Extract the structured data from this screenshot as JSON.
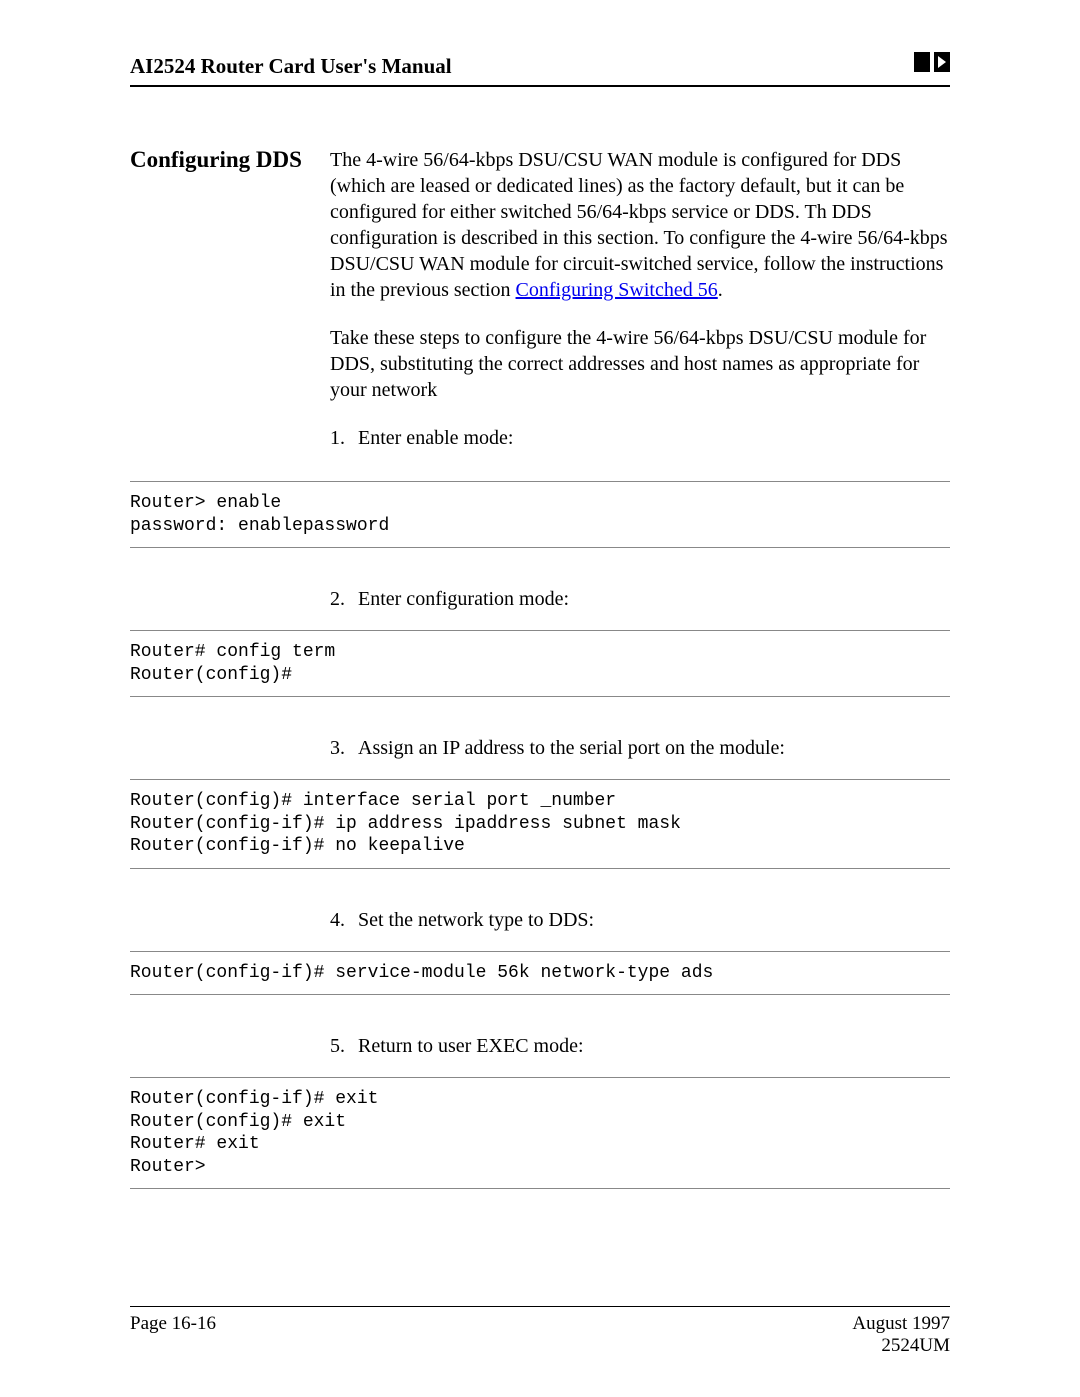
{
  "header": {
    "title": "AI2524 Router Card User's Manual"
  },
  "section": {
    "title": "Configuring DDS",
    "para1_a": "The 4-wire 56/64-kbps DSU/CSU WAN module is configured for DDS (which are leased or dedicated lines) as the factory default, but it can be configured for either switched 56/64-kbps service or DDS. Th DDS configuration is described in this section. To configure the 4-wire 56/64-kbps DSU/CSU WAN module for circuit-switched service, follow the instructions in the previous section ",
    "para1_link": "Configuring Switched 56",
    "para1_b": ".",
    "para2": "Take these steps to configure the 4-wire 56/64-kbps DSU/CSU module for DDS, substituting the correct addresses and host names as appropriate for your network",
    "steps": {
      "n1": "1.",
      "s1": "Enter enable mode:",
      "n2": "2.",
      "s2": "Enter configuration mode:",
      "n3": "3.",
      "s3": "Assign an IP address to the serial port on the module:",
      "n4": "4.",
      "s4": "Set the network type to DDS:",
      "n5": "5.",
      "s5": "Return to user EXEC mode:"
    }
  },
  "code": {
    "c1": "Router> enable\npassword: enablepassword",
    "c2": "Router# config term\nRouter(config)#",
    "c3": "Router(config)# interface serial port _number\nRouter(config-if)# ip address ipaddress subnet mask\nRouter(config-if)# no keepalive",
    "c4": "Router(config-if)# service-module 56k network-type ads",
    "c5": "Router(config-if)# exit\nRouter(config)# exit\nRouter# exit\nRouter>"
  },
  "footer": {
    "page": "Page 16-16",
    "date": "August 1997",
    "doc": "2524UM"
  }
}
